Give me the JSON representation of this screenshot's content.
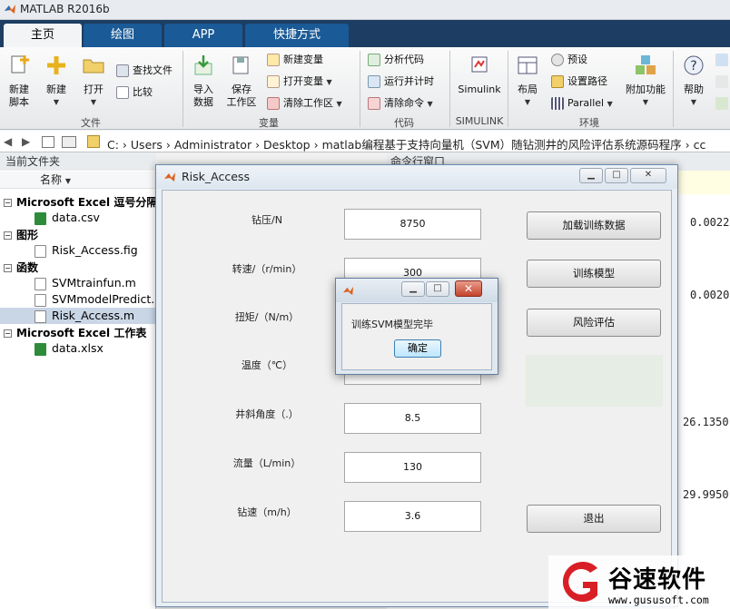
{
  "app": {
    "title": "MATLAB R2016b"
  },
  "tabs": [
    "主页",
    "绘图",
    "APP",
    "快捷方式"
  ],
  "ribbon": {
    "file": {
      "new_script": "新建\n脚本",
      "new": "新建",
      "open": "打开",
      "find_files": "查找文件",
      "compare": "比较",
      "group": "文件"
    },
    "variable": {
      "import": "导入\n数据",
      "save": "保存\n工作区",
      "new_var": "新建变量",
      "open_var": "打开变量",
      "clear_ws": "清除工作区",
      "group": "变量"
    },
    "code": {
      "analyze": "分析代码",
      "run_time": "运行并计时",
      "clear_cmd": "清除命令",
      "group": "代码"
    },
    "simulink": {
      "label": "Simulink",
      "group": "SIMULINK"
    },
    "env": {
      "layout": "布局",
      "prefs": "预设",
      "set_path": "设置路径",
      "parallel": "Parallel",
      "addons": "附加功能",
      "group": "环境"
    },
    "help": {
      "label": "帮助"
    }
  },
  "address": {
    "crumbs": [
      "C:",
      "Users",
      "Administrator",
      "Desktop",
      "matlab编程基于支持向量机（SVM）随钻测井的风险评估系统源码程序",
      "cc"
    ]
  },
  "leftpanel": {
    "title": "当前文件夹",
    "col_header": "名称",
    "sections": [
      {
        "name": "Microsoft Excel 逗号分隔值",
        "files": [
          "data.csv"
        ]
      },
      {
        "name": "图形",
        "files": [
          "Risk_Access.fig"
        ]
      },
      {
        "name": "函数",
        "files": [
          "SVMtrainfun.m",
          "SVMmodelPredict.m",
          "Risk_Access.m"
        ]
      },
      {
        "name": "Microsoft Excel 工作表",
        "files": [
          "data.xlsx"
        ]
      }
    ]
  },
  "command": {
    "title": "命令行窗口",
    "values": [
      "0.0022",
      "0.0020",
      "26.1350",
      "29.9950"
    ]
  },
  "dialog": {
    "title": "Risk_Access",
    "labels": [
      "钻压/N",
      "转速/（r/min）",
      "扭矩/（N/m）",
      "温度（℃）",
      "井斜角度（.）",
      "流量（L/min）",
      "钻速（m/h）"
    ],
    "values": [
      "8750",
      "300",
      "",
      "",
      "8.5",
      "130",
      "3.6"
    ],
    "buttons": {
      "load": "加载训练数据",
      "train": "训练模型",
      "assess": "风险评估",
      "exit": "退出"
    }
  },
  "msgbox": {
    "text": "训练SVM模型完毕",
    "ok": "确定"
  },
  "watermark": {
    "title": "谷速软件",
    "url": "www.gususoft.com"
  },
  "colors": {
    "tab_bar": "#1d3d62",
    "tab": "#1a5a96",
    "accent": "#e06a1a"
  }
}
